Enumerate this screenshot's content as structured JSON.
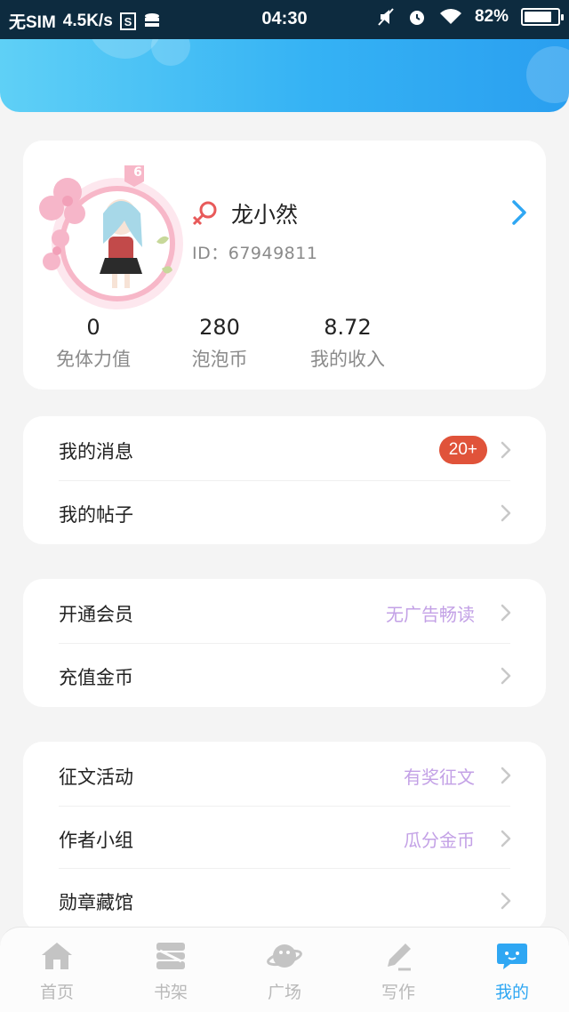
{
  "status_bar": {
    "carrier": "无SIM",
    "speed": "4.5K/s",
    "time": "04:30",
    "battery": "82%",
    "battery_level": 0.82
  },
  "profile": {
    "name": "龙小然",
    "id_text": "ID：67949811",
    "avatar_badge": "6",
    "stats": [
      {
        "value": "0",
        "label": "免体力值"
      },
      {
        "value": "280",
        "label": "泡泡币"
      },
      {
        "value": "8.72",
        "label": "我的收入"
      }
    ]
  },
  "menu_group_1": [
    {
      "label": "我的消息",
      "badge": "20+"
    },
    {
      "label": "我的帖子"
    }
  ],
  "menu_group_2": [
    {
      "label": "开通会员",
      "sub": "无广告畅读"
    },
    {
      "label": "充值金币"
    }
  ],
  "menu_group_3": [
    {
      "label": "征文活动",
      "sub": "有奖征文"
    },
    {
      "label": "作者小组",
      "sub": "瓜分金币"
    },
    {
      "label": "勋章藏馆"
    }
  ],
  "bottom_nav": [
    {
      "label": "首页",
      "icon": "home-icon"
    },
    {
      "label": "书架",
      "icon": "bookshelf-icon"
    },
    {
      "label": "广场",
      "icon": "planet-icon"
    },
    {
      "label": "写作",
      "icon": "pen-icon"
    },
    {
      "label": "我的",
      "icon": "chat-bubble-icon",
      "active": true
    }
  ],
  "colors": {
    "accent": "#2fa7f3",
    "badge": "#e0533a",
    "promo_text": "#c3a1e6",
    "header_start": "#5fd0f6",
    "header_end": "#2a9ff0"
  }
}
